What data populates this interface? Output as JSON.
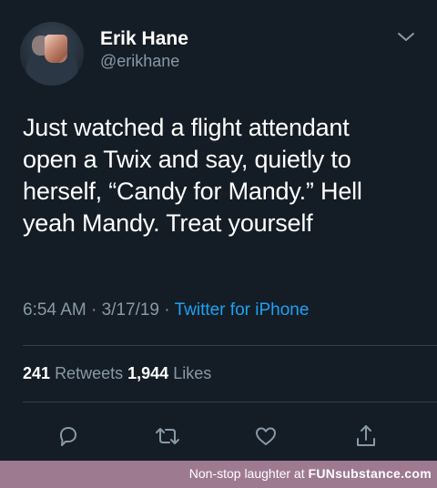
{
  "tweet": {
    "author": {
      "name": "Erik Hane",
      "handle": "@erikhane"
    },
    "text_lines": [
      "Just watched a flight attendant",
      "open a Twix and say, quietly to",
      "herself, “Candy for Mandy.” Hell",
      "yeah Mandy. Treat yourself"
    ],
    "time": "6:54 AM",
    "separator": "·",
    "date": "3/17/19",
    "source": "Twitter for iPhone",
    "retweets": {
      "count": "241",
      "label": "Retweets"
    },
    "likes": {
      "count": "1,944",
      "label": "Likes"
    },
    "actions": [
      "reply-icon",
      "retweet-icon",
      "like-icon",
      "share-icon"
    ]
  },
  "watermark": {
    "prefix": "Non-stop laughter at",
    "brand": "FUNsubstance.com"
  },
  "colors": {
    "background": "#141d26",
    "text": "#ffffff",
    "muted": "#8899a6",
    "link": "#1da1f2",
    "footer": "#9e7a91"
  }
}
